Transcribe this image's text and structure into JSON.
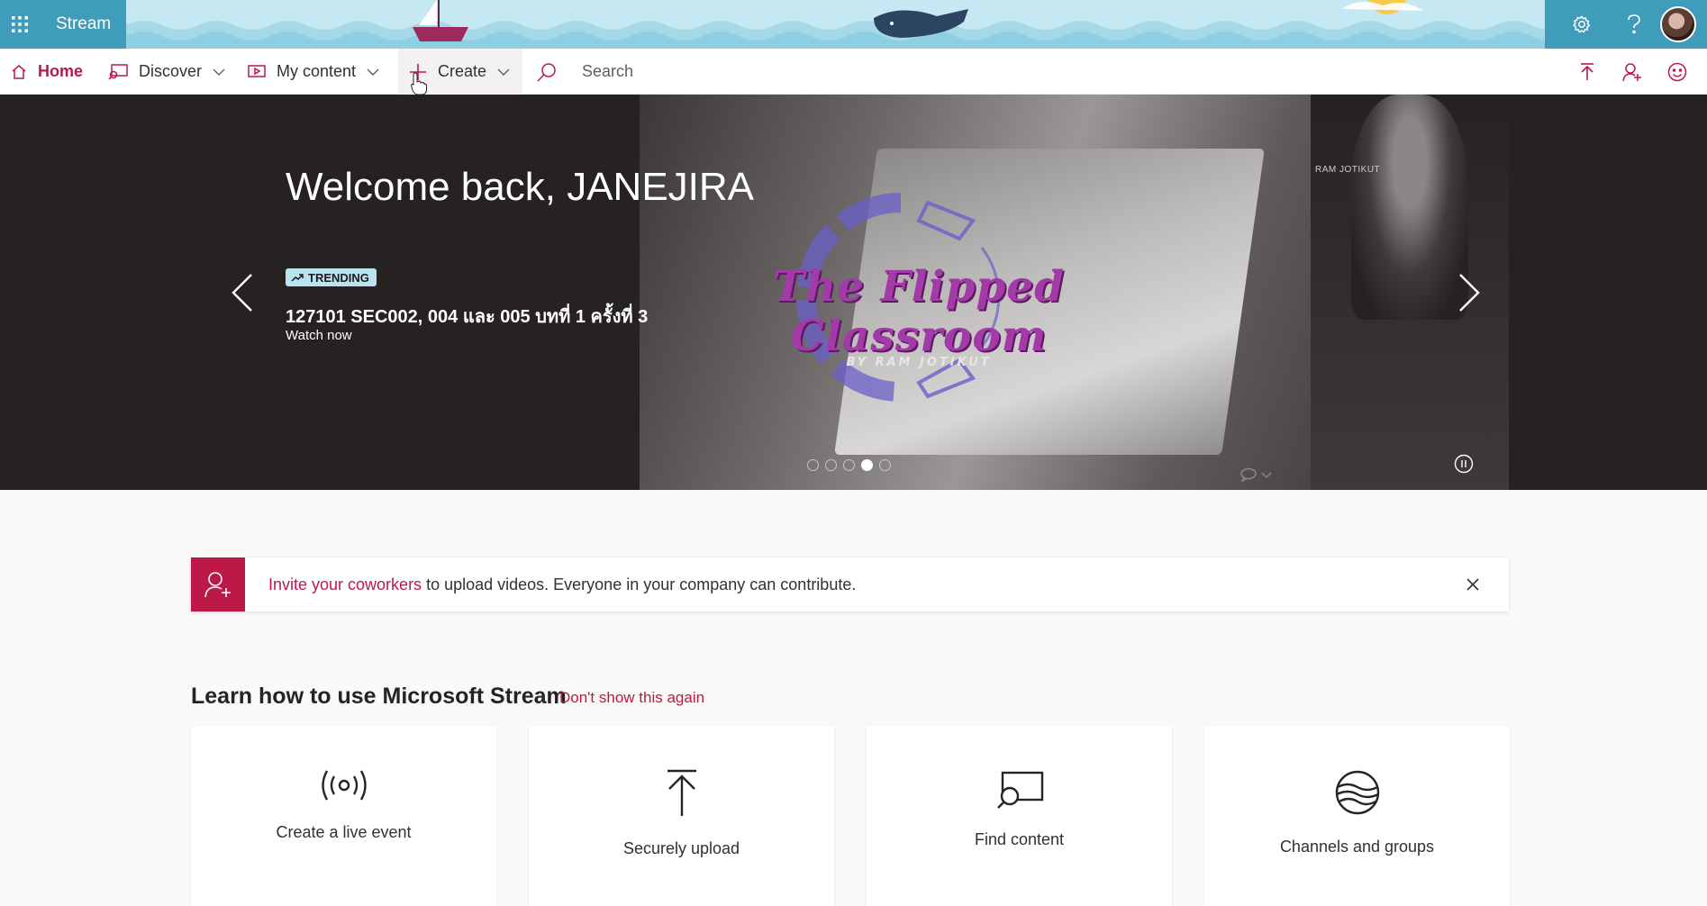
{
  "app": {
    "name": "Stream"
  },
  "nav": {
    "home": "Home",
    "discover": "Discover",
    "my_content": "My content",
    "create": "Create",
    "search_placeholder": "Search"
  },
  "hero": {
    "welcome": "Welcome back, JANEJIRA",
    "badge": "TRENDING",
    "video_title": "127101 SEC002, 004 และ 005 บทที่ 1 ครั้งที่ 3",
    "cta": "Watch now",
    "thumbnail_title": "The Flipped Classroom",
    "thumbnail_subtitle": "BY RAM JOTIKUT",
    "thumbnail_corner_text": "RAM JOTIKUT",
    "slides_total": 5,
    "active_slide": 4
  },
  "invite": {
    "link": "Invite your coworkers",
    "text": " to upload videos. Everyone in your company can contribute."
  },
  "learn": {
    "heading": "Learn how to use Microsoft Stream",
    "dismiss": "Don't show this again",
    "cards": [
      {
        "label": "Create a live event",
        "icon": "broadcast-icon"
      },
      {
        "label": "Securely upload",
        "icon": "upload-icon"
      },
      {
        "label": "Find content",
        "icon": "search-screen-icon"
      },
      {
        "label": "Channels and groups",
        "icon": "globe-lines-icon"
      }
    ]
  },
  "colors": {
    "accent": "#bc1948",
    "suite_dark": "#3f9dbb",
    "suite_light": "#8ecfe2",
    "hero_bg": "#252221",
    "badge_bg": "#b7e4f0"
  }
}
